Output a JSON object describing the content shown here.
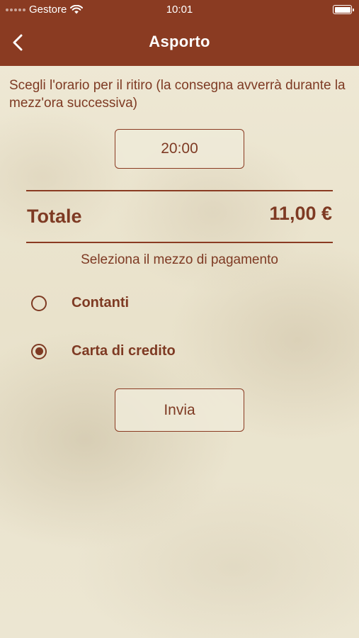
{
  "status_bar": {
    "carrier": "Gestore",
    "time": "10:01"
  },
  "header": {
    "title": "Asporto"
  },
  "instructions": "Scegli l'orario per il ritiro (la consegna avverrà durante la mezz'ora successiva)",
  "time_picker": {
    "value": "20:00"
  },
  "total": {
    "label": "Totale",
    "value": "11,00 €"
  },
  "payment": {
    "label": "Seleziona il mezzo di pagamento",
    "options": [
      {
        "label": "Contanti",
        "selected": false
      },
      {
        "label": "Carta di credito",
        "selected": true
      }
    ]
  },
  "submit": {
    "label": "Invia"
  },
  "colors": {
    "brand": "#8a3b22",
    "background": "#ebe4cf"
  }
}
